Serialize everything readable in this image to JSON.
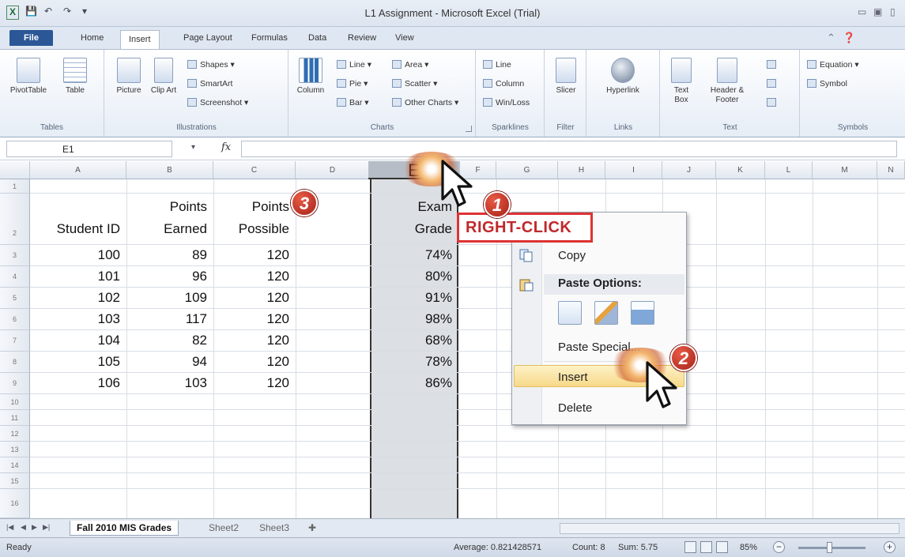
{
  "window": {
    "title": "L1 Assignment - Microsoft Excel (Trial)",
    "qat": [
      "X",
      "💾",
      "↶",
      "↷",
      "▾"
    ],
    "controls": [
      "▭",
      "▣",
      "▯"
    ]
  },
  "ribbon_tabs": [
    "File",
    "Home",
    "Insert",
    "Page Layout",
    "Formulas",
    "Data",
    "Review",
    "View"
  ],
  "active_tab": "Insert",
  "ribbon_groups": {
    "tables": {
      "label": "Tables",
      "pivot": "PivotTable",
      "table": "Table"
    },
    "illustrations": {
      "label": "Illustrations",
      "picture": "Picture",
      "clipart": "Clip Art",
      "shapes": "Shapes ▾",
      "smartart": "SmartArt",
      "screenshot": "Screenshot ▾"
    },
    "charts": {
      "label": "Charts",
      "column": "Column",
      "line": "Line ▾",
      "pie": "Pie ▾",
      "bar": "Bar ▾",
      "area": "Area ▾",
      "scatter": "Scatter ▾",
      "other": "Other Charts ▾"
    },
    "sparklines": {
      "label": "Sparklines",
      "line": "Line",
      "column": "Column",
      "winloss": "Win/Loss"
    },
    "filter": {
      "label": "Filter",
      "slicer": "Slicer"
    },
    "links": {
      "label": "Links",
      "hyperlink": "Hyperlink"
    },
    "text": {
      "label": "Text",
      "textbox": "Text Box",
      "header": "Header & Footer"
    },
    "symbols": {
      "label": "Symbols",
      "equation": "Equation ▾",
      "symbol": "Symbol"
    }
  },
  "formula_bar": {
    "name_box": "E1",
    "fx": "fx",
    "formula": ""
  },
  "columns": [
    "A",
    "B",
    "C",
    "D",
    "E",
    "F",
    "G",
    "H",
    "I",
    "J",
    "K",
    "L",
    "M",
    "N"
  ],
  "selected_column": "E",
  "rows": [
    "1",
    "2",
    "3",
    "4",
    "5",
    "6",
    "7",
    "8",
    "9",
    "10",
    "11",
    "12",
    "13",
    "14",
    "15",
    "16"
  ],
  "headers": {
    "student_id": "Student ID",
    "points_earned_1": "Points",
    "points_earned_2": "Earned",
    "points_possible_1": "Points",
    "points_possible_2": "Possible",
    "exam_grade_1": "Exam",
    "exam_grade_2": "Grade"
  },
  "data_rows": [
    {
      "id": "100",
      "earned": "89",
      "possible": "120",
      "grade": "74%"
    },
    {
      "id": "101",
      "earned": "96",
      "possible": "120",
      "grade": "80%"
    },
    {
      "id": "102",
      "earned": "109",
      "possible": "120",
      "grade": "91%"
    },
    {
      "id": "103",
      "earned": "117",
      "possible": "120",
      "grade": "98%"
    },
    {
      "id": "104",
      "earned": "82",
      "possible": "120",
      "grade": "68%"
    },
    {
      "id": "105",
      "earned": "94",
      "possible": "120",
      "grade": "78%"
    },
    {
      "id": "106",
      "earned": "103",
      "possible": "120",
      "grade": "86%"
    }
  ],
  "context_menu": {
    "copy": "Copy",
    "paste_options": "Paste Options:",
    "paste_special": "Paste Special...",
    "insert": "Insert",
    "delete": "Delete"
  },
  "annotations": {
    "callout": "RIGHT-CLICK",
    "step1": "1",
    "step2": "2",
    "step3": "3",
    "accent_color": "#d33333"
  },
  "sheets": [
    "Fall 2010 MIS Grades",
    "Sheet2",
    "Sheet3"
  ],
  "active_sheet": "Fall 2010 MIS Grades",
  "status": {
    "ready": "Ready",
    "average": "Average: 0.821428571",
    "count": "Count: 8",
    "sum": "Sum: 5.75",
    "zoom": "85%"
  }
}
